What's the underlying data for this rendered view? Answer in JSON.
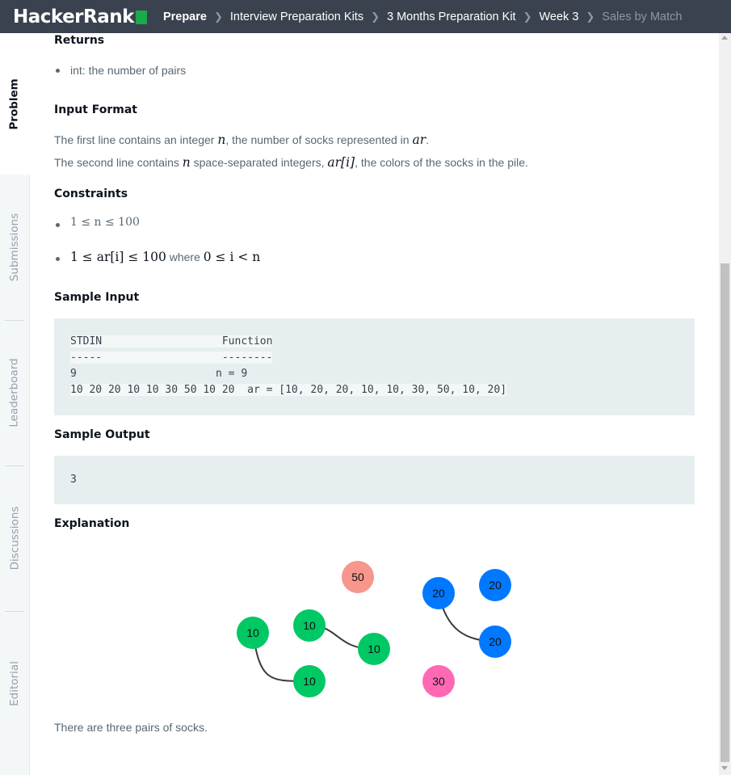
{
  "nav": {
    "logo": "HackerRank",
    "breadcrumbs": [
      "Prepare",
      "Interview Preparation Kits",
      "3 Months Preparation Kit",
      "Week 3",
      "Sales by Match"
    ]
  },
  "tabs": [
    "Problem",
    "Submissions",
    "Leaderboard",
    "Discussions",
    "Editorial"
  ],
  "problem": {
    "returns_heading": "Returns",
    "returns_item": "int: the number of pairs",
    "input_heading": "Input Format",
    "input_line1": {
      "a": "The first line contains an integer ",
      "v1": "n",
      "b": ", the number of socks represented in ",
      "v2": "ar",
      "c": "."
    },
    "input_line2": {
      "a": "The second line contains ",
      "v1": "n",
      "b": " space-separated integers, ",
      "v2": "ar[i]",
      "c": ", the colors of the socks in the pile."
    },
    "constraints_heading": "Constraints",
    "constraint1": "1 ≤ n ≤ 100",
    "constraint2": {
      "a": "1 ≤ ar[i] ≤ 100",
      "b": " where ",
      "c": "0 ≤ i < n"
    },
    "sample_input_heading": "Sample Input",
    "sample_input_lines": [
      "STDIN                   Function",
      "-----                   --------",
      "9                      n = 9",
      "10 20 20 10 10 30 50 10 20  ar = [10, 20, 20, 10, 10, 30, 50, 10, 20]"
    ],
    "sample_output_heading": "Sample Output",
    "sample_output": "3",
    "explanation_heading": "Explanation",
    "explanation_text": "There are three pairs of socks."
  },
  "illustration": {
    "colors": {
      "green": "#00c864",
      "blue": "#0078ff",
      "salmon": "#f7968c",
      "pink": "#ff69b4",
      "connector": "#3a3a3a"
    },
    "socks": [
      {
        "label": "50",
        "color": "salmon"
      },
      {
        "label": "20",
        "color": "blue"
      },
      {
        "label": "20",
        "color": "blue"
      },
      {
        "label": "10",
        "color": "green"
      },
      {
        "label": "10",
        "color": "green"
      },
      {
        "label": "10",
        "color": "green"
      },
      {
        "label": "20",
        "color": "blue"
      },
      {
        "label": "10",
        "color": "green"
      },
      {
        "label": "30",
        "color": "pink"
      }
    ]
  }
}
